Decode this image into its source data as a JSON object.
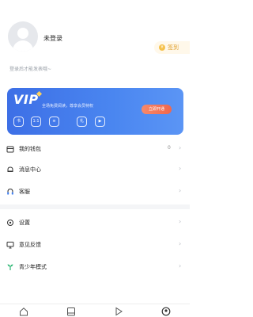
{
  "profile": {
    "login_label": "未登录",
    "subtitle": "登录后才能发表哦~"
  },
  "checkin": {
    "label": "签到",
    "coin_glyph": "¥"
  },
  "vip": {
    "logo": "VIP",
    "description": "全场免费阅读，尊享会员特权",
    "button_label": "立即开通",
    "perks": [
      "书",
      "1:1",
      "≡",
      "礼",
      "▶"
    ]
  },
  "menu": {
    "items": [
      {
        "label": "我的钱包",
        "count": "0"
      },
      {
        "label": "消息中心",
        "count": ""
      },
      {
        "label": "客服",
        "count": ""
      },
      {
        "label": "设置",
        "count": ""
      },
      {
        "label": "意见反馈",
        "count": ""
      },
      {
        "label": "青少年模式",
        "count": ""
      }
    ],
    "chevron": "›"
  },
  "tabbar": {
    "tabs": [
      "home-icon",
      "bookshelf-icon",
      "play-icon",
      "profile-icon"
    ]
  }
}
